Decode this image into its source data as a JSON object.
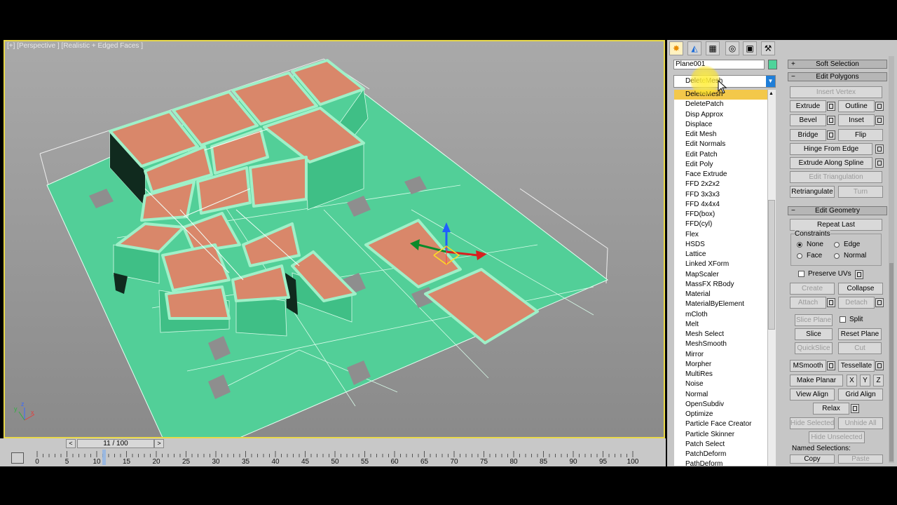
{
  "viewport": {
    "label": "[+] [Perspective ] [Realistic + Edged Faces ]",
    "axis_x": "x",
    "axis_y": "y",
    "axis_z": "z",
    "colors": {
      "plane": "#52cf98",
      "face_top": "#d9876a",
      "bg_top": "#a9a9a9",
      "bg_bottom": "#8a8a8a",
      "border": "#e8d84a"
    }
  },
  "timeline": {
    "frame_display": "11 / 100",
    "prev_label": "<",
    "next_label": ">",
    "ticks": [
      "0",
      "5",
      "10",
      "15",
      "20",
      "25",
      "30",
      "35",
      "40",
      "45",
      "50",
      "55",
      "60",
      "65",
      "70",
      "75",
      "80",
      "85",
      "90",
      "95",
      "100"
    ]
  },
  "command_panel": {
    "tab_icons": [
      "create-icon",
      "modify-icon",
      "hierarchy-icon",
      "motion-icon",
      "display-icon",
      "utilities-icon"
    ],
    "object_name": "Plane001",
    "object_color": "#4fd39a",
    "modifier_selected": "DeleteMesh",
    "modifier_list": [
      "DeleteMesh",
      "DeletePatch",
      "Disp Approx",
      "Displace",
      "Edit Mesh",
      "Edit Normals",
      "Edit Patch",
      "Edit Poly",
      "Face Extrude",
      "FFD 2x2x2",
      "FFD 3x3x3",
      "FFD 4x4x4",
      "FFD(box)",
      "FFD(cyl)",
      "Flex",
      "HSDS",
      "Lattice",
      "Linked XForm",
      "MapScaler",
      "MassFX RBody",
      "Material",
      "MaterialByElement",
      "mCloth",
      "Melt",
      "Mesh Select",
      "MeshSmooth",
      "Mirror",
      "Morpher",
      "MultiRes",
      "Noise",
      "Normal",
      "OpenSubdiv",
      "Optimize",
      "Particle Face Creator",
      "Particle Skinner",
      "Patch Select",
      "PatchDeform",
      "PathDeform"
    ]
  },
  "rollouts": {
    "soft_selection": {
      "sign": "+",
      "title": "Soft Selection"
    },
    "edit_polygons": {
      "sign": "−",
      "title": "Edit Polygons",
      "insert_vertex": "Insert Vertex",
      "extrude": "Extrude",
      "outline": "Outline",
      "bevel": "Bevel",
      "inset": "Inset",
      "bridge": "Bridge",
      "flip": "Flip",
      "hinge_from_edge": "Hinge From Edge",
      "extrude_along_spline": "Extrude Along Spline",
      "edit_triangulation": "Edit Triangulation",
      "retriangulate": "Retriangulate",
      "turn": "Turn"
    },
    "edit_geometry": {
      "sign": "−",
      "title": "Edit Geometry",
      "repeat_last": "Repeat Last",
      "constraints": "Constraints",
      "none": "None",
      "edge": "Edge",
      "face": "Face",
      "normal": "Normal",
      "preserve_uvs": "Preserve UVs",
      "create": "Create",
      "collapse": "Collapse",
      "attach": "Attach",
      "detach": "Detach",
      "slice_plane": "Slice Plane",
      "split": "Split",
      "slice": "Slice",
      "reset_plane": "Reset Plane",
      "quickslice": "QuickSlice",
      "cut": "Cut",
      "msmooth": "MSmooth",
      "tessellate": "Tessellate",
      "make_planar": "Make Planar",
      "x": "X",
      "y": "Y",
      "z": "Z",
      "view_align": "View Align",
      "grid_align": "Grid Align",
      "relax": "Relax",
      "hide_selected": "Hide Selected",
      "unhide_all": "Unhide All",
      "hide_unselected": "Hide Unselected",
      "named_selections": "Named Selections:",
      "copy": "Copy",
      "paste": "Paste"
    }
  }
}
